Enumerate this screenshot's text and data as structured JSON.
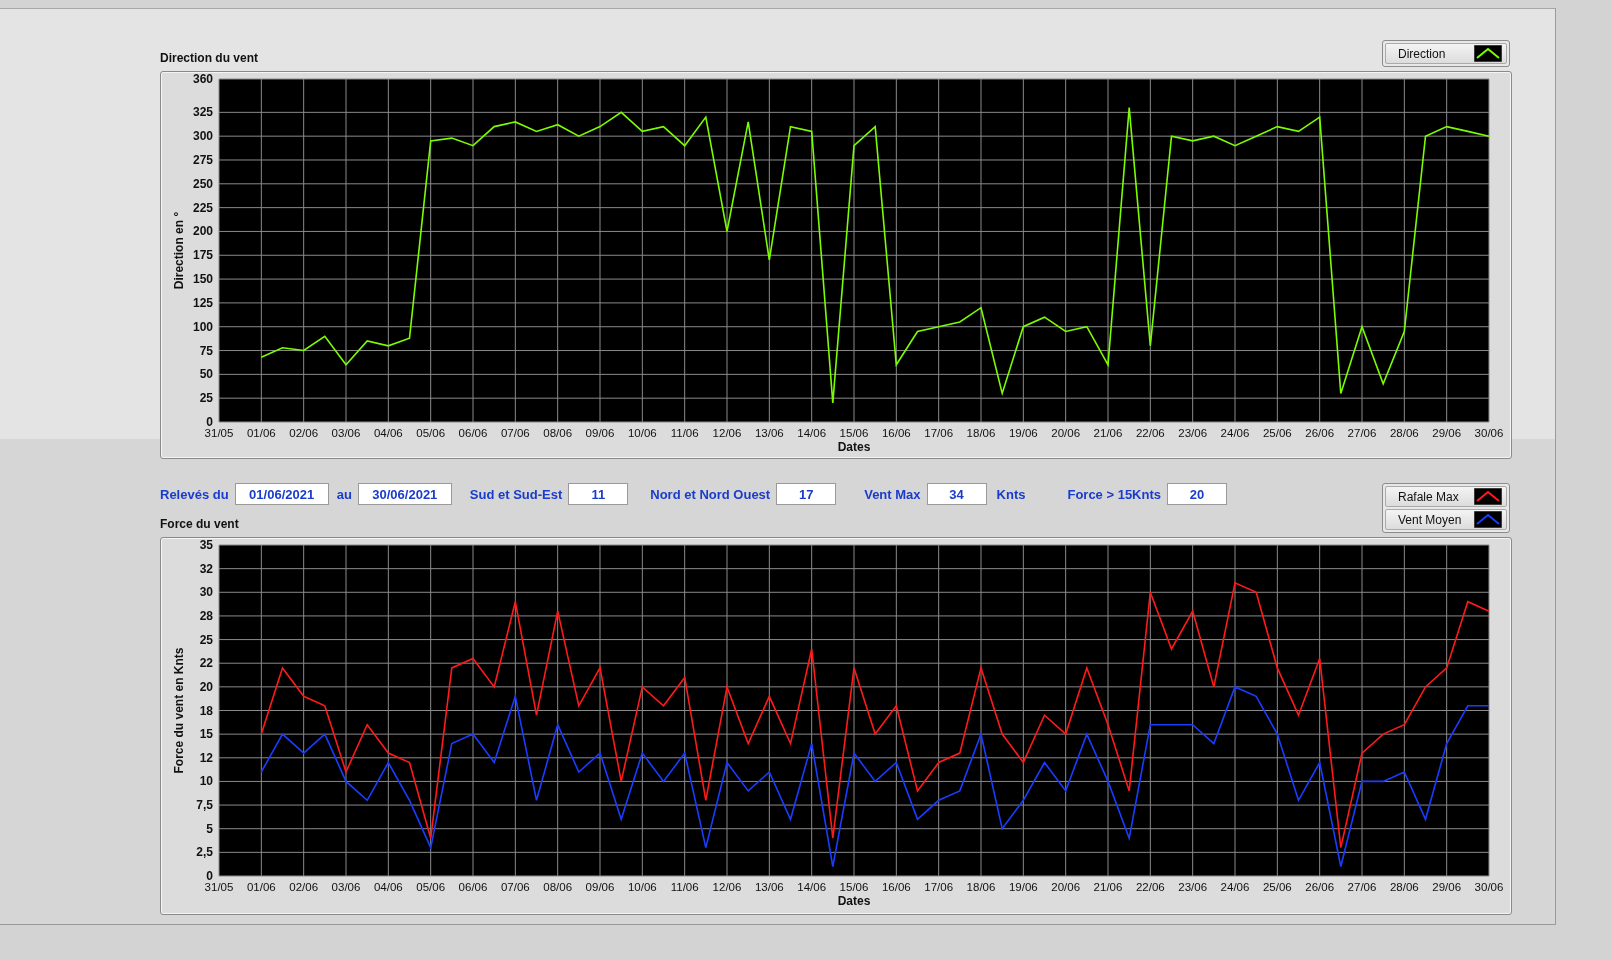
{
  "direction_chart": {
    "title": "Direction du vent",
    "chart_data": {
      "type": "line",
      "grid": true,
      "xlabel": "Dates",
      "ylabel": "Direction en °",
      "ylim": [
        0,
        360
      ],
      "categories": [
        "31/05",
        null,
        "01/06",
        null,
        "02/06",
        null,
        "03/06",
        null,
        "04/06",
        null,
        "05/06",
        null,
        "06/06",
        null,
        "07/06",
        null,
        "08/06",
        null,
        "09/06",
        null,
        "10/06",
        null,
        "11/06",
        null,
        "12/06",
        null,
        "13/06",
        null,
        "14/06",
        null,
        "15/06",
        null,
        "16/06",
        null,
        "17/06",
        null,
        "18/06",
        null,
        "19/06",
        null,
        "20/06",
        null,
        "21/06",
        null,
        "22/06",
        null,
        "23/06",
        null,
        "24/06",
        null,
        "25/06",
        null,
        "26/06",
        null,
        "27/06",
        null,
        "28/06",
        null,
        "29/06",
        null,
        "30/06"
      ],
      "yticks": [
        0,
        25,
        50,
        75,
        100,
        125,
        150,
        175,
        200,
        225,
        250,
        275,
        300,
        325,
        360
      ],
      "series": [
        {
          "name": "Direction",
          "color": "#7cfc00",
          "values": [
            null,
            null,
            68,
            78,
            75,
            90,
            60,
            85,
            80,
            88,
            295,
            298,
            290,
            310,
            315,
            305,
            312,
            300,
            310,
            325,
            305,
            310,
            290,
            320,
            200,
            315,
            170,
            310,
            305,
            20,
            290,
            310,
            60,
            95,
            100,
            105,
            120,
            30,
            100,
            110,
            95,
            100,
            60,
            330,
            80,
            300,
            295,
            300,
            290,
            300,
            310,
            305,
            320,
            30,
            100,
            40,
            95,
            300,
            310,
            305,
            300
          ]
        }
      ]
    }
  },
  "filters": [
    {
      "label": "Relevés du",
      "value": "01/06/2021"
    },
    {
      "label": "au",
      "value": "30/06/2021"
    },
    {
      "label": "Sud et Sud-Est",
      "value": "11"
    },
    {
      "label": "Nord et Nord Ouest",
      "value": "17"
    },
    {
      "label": "Vent Max",
      "value": "34",
      "unit": "Knts"
    },
    {
      "label": "Force > 15Knts",
      "value": "20"
    }
  ],
  "force_chart": {
    "title": "Force du vent",
    "chart_data": {
      "type": "line",
      "grid": true,
      "xlabel": "Dates",
      "ylabel": "Force du vent en Knts",
      "ylim": [
        0,
        35
      ],
      "categories": [
        "31/05",
        null,
        "01/06",
        null,
        "02/06",
        null,
        "03/06",
        null,
        "04/06",
        null,
        "05/06",
        null,
        "06/06",
        null,
        "07/06",
        null,
        "08/06",
        null,
        "09/06",
        null,
        "10/06",
        null,
        "11/06",
        null,
        "12/06",
        null,
        "13/06",
        null,
        "14/06",
        null,
        "15/06",
        null,
        "16/06",
        null,
        "17/06",
        null,
        "18/06",
        null,
        "19/06",
        null,
        "20/06",
        null,
        "21/06",
        null,
        "22/06",
        null,
        "23/06",
        null,
        "24/06",
        null,
        "25/06",
        null,
        "26/06",
        null,
        "27/06",
        null,
        "28/06",
        null,
        "29/06",
        null,
        "30/06"
      ],
      "yticks": [
        0,
        {
          "value": 2.5,
          "label": "2,5"
        },
        5,
        {
          "value": 7.5,
          "label": "7,5"
        },
        10,
        {
          "value": 12.5,
          "label": "12"
        },
        15,
        {
          "value": 17.5,
          "label": "18"
        },
        20,
        {
          "value": 22.5,
          "label": "22"
        },
        25,
        {
          "value": 27.5,
          "label": "28"
        },
        30,
        {
          "value": 32.5,
          "label": "32"
        },
        35
      ],
      "series": [
        {
          "name": "Rafale Max",
          "color": "#ff1a1a",
          "values": [
            null,
            null,
            15,
            22,
            19,
            18,
            11,
            16,
            13,
            12,
            4,
            22,
            23,
            20,
            29,
            17,
            28,
            18,
            22,
            10,
            20,
            18,
            21,
            8,
            20,
            14,
            19,
            14,
            24,
            4,
            22,
            15,
            18,
            9,
            12,
            13,
            22,
            15,
            12,
            17,
            15,
            22,
            16,
            9,
            30,
            24,
            28,
            20,
            31,
            30,
            22,
            17,
            23,
            3,
            13,
            15,
            16,
            20,
            22,
            29,
            28
          ]
        },
        {
          "name": "Vent Moyen",
          "color": "#1a3cff",
          "values": [
            null,
            null,
            11,
            15,
            13,
            15,
            10,
            8,
            12,
            8,
            3,
            14,
            15,
            12,
            19,
            8,
            16,
            11,
            13,
            6,
            13,
            10,
            13,
            3,
            12,
            9,
            11,
            6,
            14,
            1,
            13,
            10,
            12,
            6,
            8,
            9,
            15,
            5,
            8,
            12,
            9,
            15,
            10,
            4,
            16,
            16,
            16,
            14,
            20,
            19,
            15,
            8,
            12,
            1,
            10,
            10,
            11,
            6,
            14,
            18,
            18
          ]
        }
      ]
    }
  }
}
